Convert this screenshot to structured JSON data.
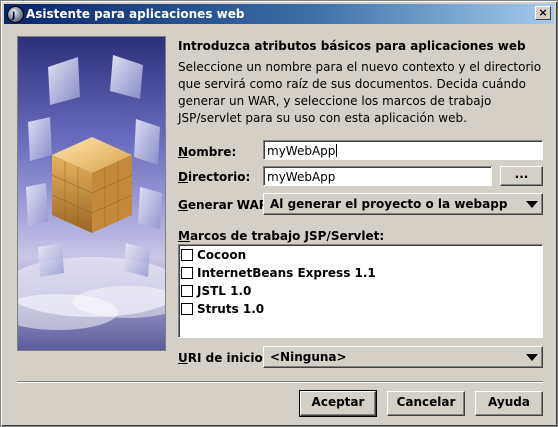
{
  "window": {
    "title": "Asistente para aplicaciones web",
    "close_glyph": "×"
  },
  "content": {
    "heading": "Introduzca atributos básicos para aplicaciones web",
    "description": "Seleccione un nombre para el nuevo contexto y el directorio que servirá como raíz de sus documentos. Decida cuándo generar un WAR, y seleccione los marcos de trabajo JSP/servlet para su uso con esta aplicación web."
  },
  "form": {
    "nombre": {
      "label_mnemonic": "N",
      "label_rest": "ombre:",
      "value": "myWebApp"
    },
    "directorio": {
      "label_mnemonic": "D",
      "label_rest": "irectorio:",
      "value": "myWebApp",
      "browse_label": "..."
    },
    "generar_war": {
      "label_mnemonic": "G",
      "label_rest": "enerar WAR:",
      "value": "Al generar el proyecto o la webapp"
    },
    "marcos": {
      "label_mnemonic": "M",
      "label_rest": "arcos de trabajo JSP/Servlet:",
      "items": [
        {
          "label": "Cocoon",
          "checked": false
        },
        {
          "label": "InternetBeans Express 1.1",
          "checked": false
        },
        {
          "label": "JSTL 1.0",
          "checked": false
        },
        {
          "label": "Struts 1.0",
          "checked": false
        }
      ]
    },
    "uri": {
      "label_mnemonic": "U",
      "label_rest": "RI de inicio:",
      "value": "<Ninguna>"
    }
  },
  "buttons": {
    "accept": "Aceptar",
    "cancel": "Cancelar",
    "help": "Ayuda"
  },
  "colors": {
    "titlebar_start": "#0a246a",
    "titlebar_end": "#a6caf0",
    "dialog_bg": "#d4d0c8"
  }
}
